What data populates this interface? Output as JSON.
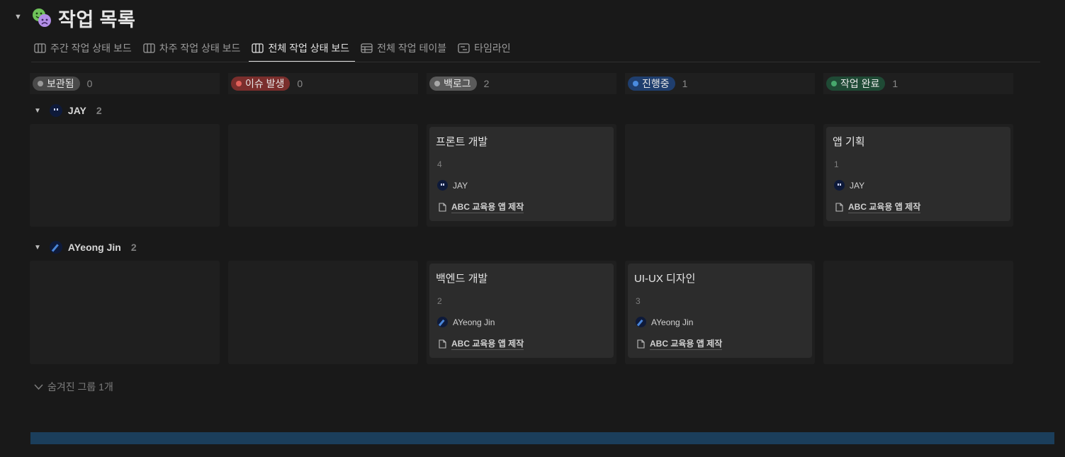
{
  "page": {
    "title": "작업 목록",
    "icon": "theater-masks-icon"
  },
  "tabs": [
    {
      "label": "주간 작업 상태 보드",
      "icon": "board-icon"
    },
    {
      "label": "차주 작업 상태 보드",
      "icon": "board-icon"
    },
    {
      "label": "전체 작업 상태 보드",
      "icon": "board-icon",
      "active": true
    },
    {
      "label": "전체 작업 테이블",
      "icon": "table-icon"
    },
    {
      "label": "타임라인",
      "icon": "timeline-icon"
    }
  ],
  "columns": [
    {
      "label": "보관됨",
      "count": "0",
      "pill_bg": "#4a4a4a",
      "dot": "#9a9a9a"
    },
    {
      "label": "이슈 발생",
      "count": "0",
      "pill_bg": "#7a2e2c",
      "dot": "#e0605a"
    },
    {
      "label": "백로그",
      "count": "2",
      "pill_bg": "#5a5a5a",
      "dot": "#a8a8a8"
    },
    {
      "label": "진행중",
      "count": "1",
      "pill_bg": "#1f3e6e",
      "dot": "#4a8be0"
    },
    {
      "label": "작업 완료",
      "count": "1",
      "pill_bg": "#1f4a35",
      "dot": "#47a86d"
    }
  ],
  "groups": [
    {
      "name": "JAY",
      "count": "2",
      "cards": {
        "backlog": {
          "title": "프론트 개발",
          "number": "4",
          "person": "JAY",
          "project": "ABC 교육용 앱 제작"
        },
        "done": {
          "title": "앱 기획",
          "number": "1",
          "person": "JAY",
          "project": "ABC 교육용 앱 제작"
        }
      }
    },
    {
      "name": "AYeong Jin",
      "count": "2",
      "cards": {
        "backlog": {
          "title": "백엔드 개발",
          "number": "2",
          "person": "AYeong Jin",
          "project": "ABC 교육용 앱 제작"
        },
        "progress": {
          "title": "UI-UX 디자인",
          "number": "3",
          "person": "AYeong Jin",
          "project": "ABC 교육용 앱 제작"
        }
      }
    }
  ],
  "hidden_groups_label": "숨겨진 그룹 1개"
}
